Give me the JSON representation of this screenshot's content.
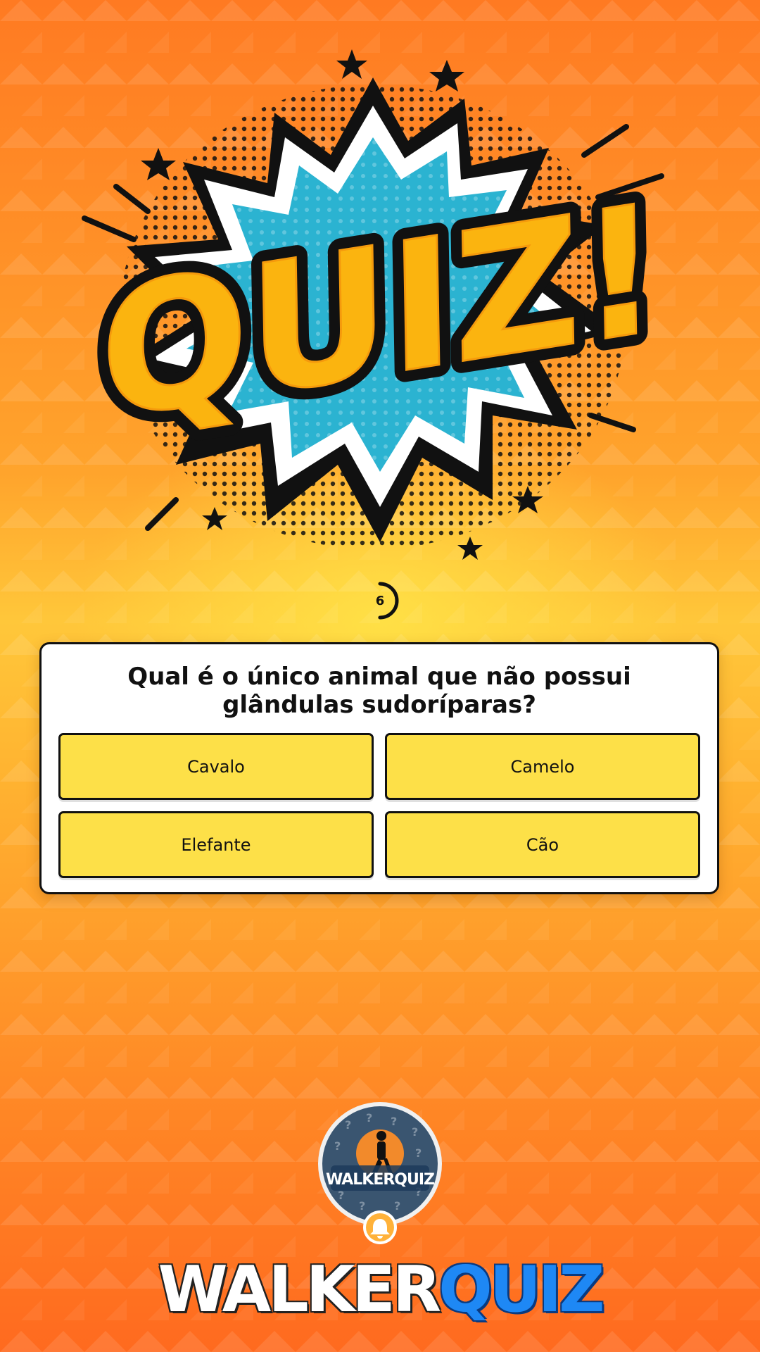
{
  "app": {
    "logo_text": "QUIZ!",
    "timer_value": "6",
    "timer_progress": 0.5
  },
  "question": {
    "text": "Qual é o único animal que não possui glândulas sudoríparas?"
  },
  "answers": [
    {
      "label": "Cavalo"
    },
    {
      "label": "Camelo"
    },
    {
      "label": "Elefante"
    },
    {
      "label": "Cão"
    }
  ],
  "footer": {
    "avatar_label": "WALKERQUIZ",
    "brand_part1": "WALKER",
    "brand_part2": "QUIZ"
  },
  "colors": {
    "background_top": "#ff7a22",
    "background_center": "#ffc73a",
    "answer_fill": "#fde048",
    "brand_blue": "#1e88f5"
  }
}
